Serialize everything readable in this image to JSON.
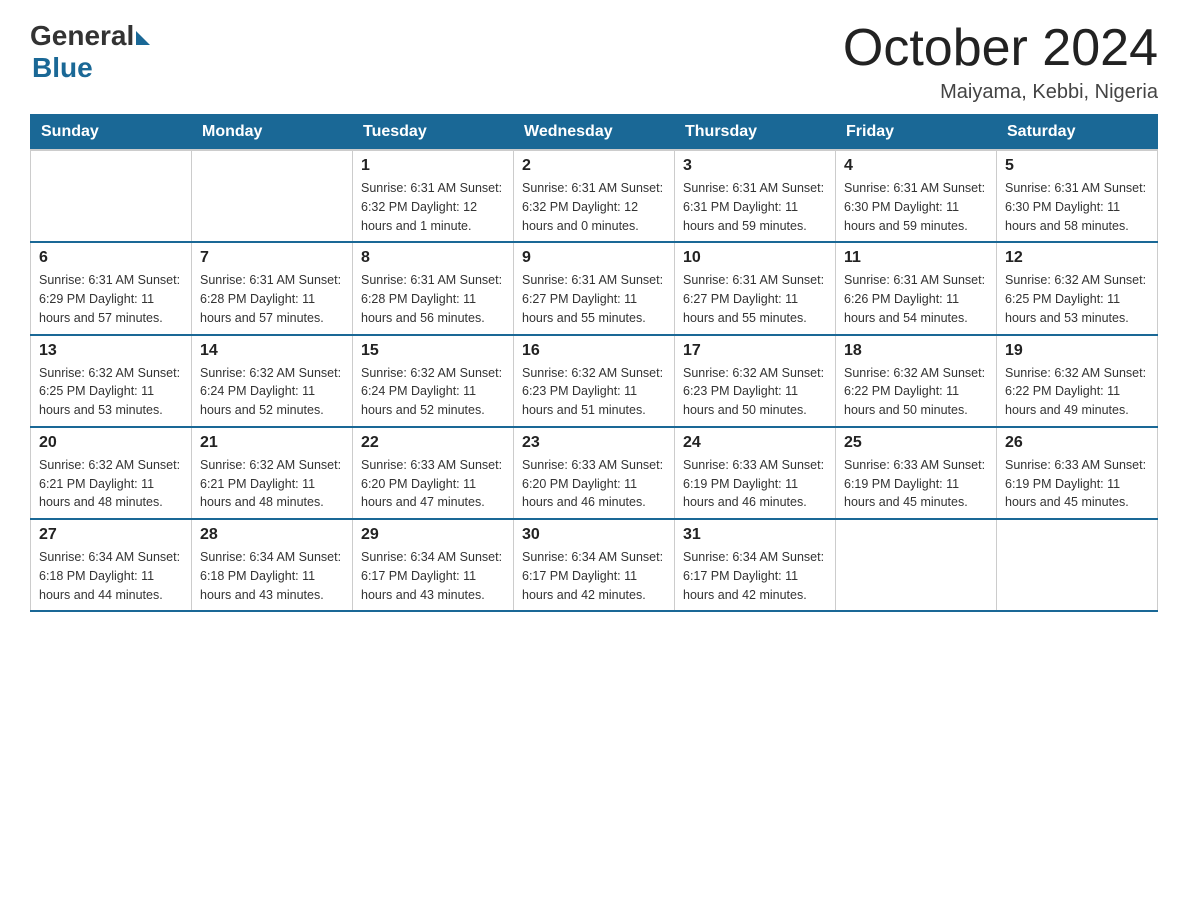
{
  "logo": {
    "general": "General",
    "blue": "Blue"
  },
  "title": "October 2024",
  "location": "Maiyama, Kebbi, Nigeria",
  "days_of_week": [
    "Sunday",
    "Monday",
    "Tuesday",
    "Wednesday",
    "Thursday",
    "Friday",
    "Saturday"
  ],
  "weeks": [
    [
      {
        "day": "",
        "info": ""
      },
      {
        "day": "",
        "info": ""
      },
      {
        "day": "1",
        "info": "Sunrise: 6:31 AM\nSunset: 6:32 PM\nDaylight: 12 hours\nand 1 minute."
      },
      {
        "day": "2",
        "info": "Sunrise: 6:31 AM\nSunset: 6:32 PM\nDaylight: 12 hours\nand 0 minutes."
      },
      {
        "day": "3",
        "info": "Sunrise: 6:31 AM\nSunset: 6:31 PM\nDaylight: 11 hours\nand 59 minutes."
      },
      {
        "day": "4",
        "info": "Sunrise: 6:31 AM\nSunset: 6:30 PM\nDaylight: 11 hours\nand 59 minutes."
      },
      {
        "day": "5",
        "info": "Sunrise: 6:31 AM\nSunset: 6:30 PM\nDaylight: 11 hours\nand 58 minutes."
      }
    ],
    [
      {
        "day": "6",
        "info": "Sunrise: 6:31 AM\nSunset: 6:29 PM\nDaylight: 11 hours\nand 57 minutes."
      },
      {
        "day": "7",
        "info": "Sunrise: 6:31 AM\nSunset: 6:28 PM\nDaylight: 11 hours\nand 57 minutes."
      },
      {
        "day": "8",
        "info": "Sunrise: 6:31 AM\nSunset: 6:28 PM\nDaylight: 11 hours\nand 56 minutes."
      },
      {
        "day": "9",
        "info": "Sunrise: 6:31 AM\nSunset: 6:27 PM\nDaylight: 11 hours\nand 55 minutes."
      },
      {
        "day": "10",
        "info": "Sunrise: 6:31 AM\nSunset: 6:27 PM\nDaylight: 11 hours\nand 55 minutes."
      },
      {
        "day": "11",
        "info": "Sunrise: 6:31 AM\nSunset: 6:26 PM\nDaylight: 11 hours\nand 54 minutes."
      },
      {
        "day": "12",
        "info": "Sunrise: 6:32 AM\nSunset: 6:25 PM\nDaylight: 11 hours\nand 53 minutes."
      }
    ],
    [
      {
        "day": "13",
        "info": "Sunrise: 6:32 AM\nSunset: 6:25 PM\nDaylight: 11 hours\nand 53 minutes."
      },
      {
        "day": "14",
        "info": "Sunrise: 6:32 AM\nSunset: 6:24 PM\nDaylight: 11 hours\nand 52 minutes."
      },
      {
        "day": "15",
        "info": "Sunrise: 6:32 AM\nSunset: 6:24 PM\nDaylight: 11 hours\nand 52 minutes."
      },
      {
        "day": "16",
        "info": "Sunrise: 6:32 AM\nSunset: 6:23 PM\nDaylight: 11 hours\nand 51 minutes."
      },
      {
        "day": "17",
        "info": "Sunrise: 6:32 AM\nSunset: 6:23 PM\nDaylight: 11 hours\nand 50 minutes."
      },
      {
        "day": "18",
        "info": "Sunrise: 6:32 AM\nSunset: 6:22 PM\nDaylight: 11 hours\nand 50 minutes."
      },
      {
        "day": "19",
        "info": "Sunrise: 6:32 AM\nSunset: 6:22 PM\nDaylight: 11 hours\nand 49 minutes."
      }
    ],
    [
      {
        "day": "20",
        "info": "Sunrise: 6:32 AM\nSunset: 6:21 PM\nDaylight: 11 hours\nand 48 minutes."
      },
      {
        "day": "21",
        "info": "Sunrise: 6:32 AM\nSunset: 6:21 PM\nDaylight: 11 hours\nand 48 minutes."
      },
      {
        "day": "22",
        "info": "Sunrise: 6:33 AM\nSunset: 6:20 PM\nDaylight: 11 hours\nand 47 minutes."
      },
      {
        "day": "23",
        "info": "Sunrise: 6:33 AM\nSunset: 6:20 PM\nDaylight: 11 hours\nand 46 minutes."
      },
      {
        "day": "24",
        "info": "Sunrise: 6:33 AM\nSunset: 6:19 PM\nDaylight: 11 hours\nand 46 minutes."
      },
      {
        "day": "25",
        "info": "Sunrise: 6:33 AM\nSunset: 6:19 PM\nDaylight: 11 hours\nand 45 minutes."
      },
      {
        "day": "26",
        "info": "Sunrise: 6:33 AM\nSunset: 6:19 PM\nDaylight: 11 hours\nand 45 minutes."
      }
    ],
    [
      {
        "day": "27",
        "info": "Sunrise: 6:34 AM\nSunset: 6:18 PM\nDaylight: 11 hours\nand 44 minutes."
      },
      {
        "day": "28",
        "info": "Sunrise: 6:34 AM\nSunset: 6:18 PM\nDaylight: 11 hours\nand 43 minutes."
      },
      {
        "day": "29",
        "info": "Sunrise: 6:34 AM\nSunset: 6:17 PM\nDaylight: 11 hours\nand 43 minutes."
      },
      {
        "day": "30",
        "info": "Sunrise: 6:34 AM\nSunset: 6:17 PM\nDaylight: 11 hours\nand 42 minutes."
      },
      {
        "day": "31",
        "info": "Sunrise: 6:34 AM\nSunset: 6:17 PM\nDaylight: 11 hours\nand 42 minutes."
      },
      {
        "day": "",
        "info": ""
      },
      {
        "day": "",
        "info": ""
      }
    ]
  ]
}
